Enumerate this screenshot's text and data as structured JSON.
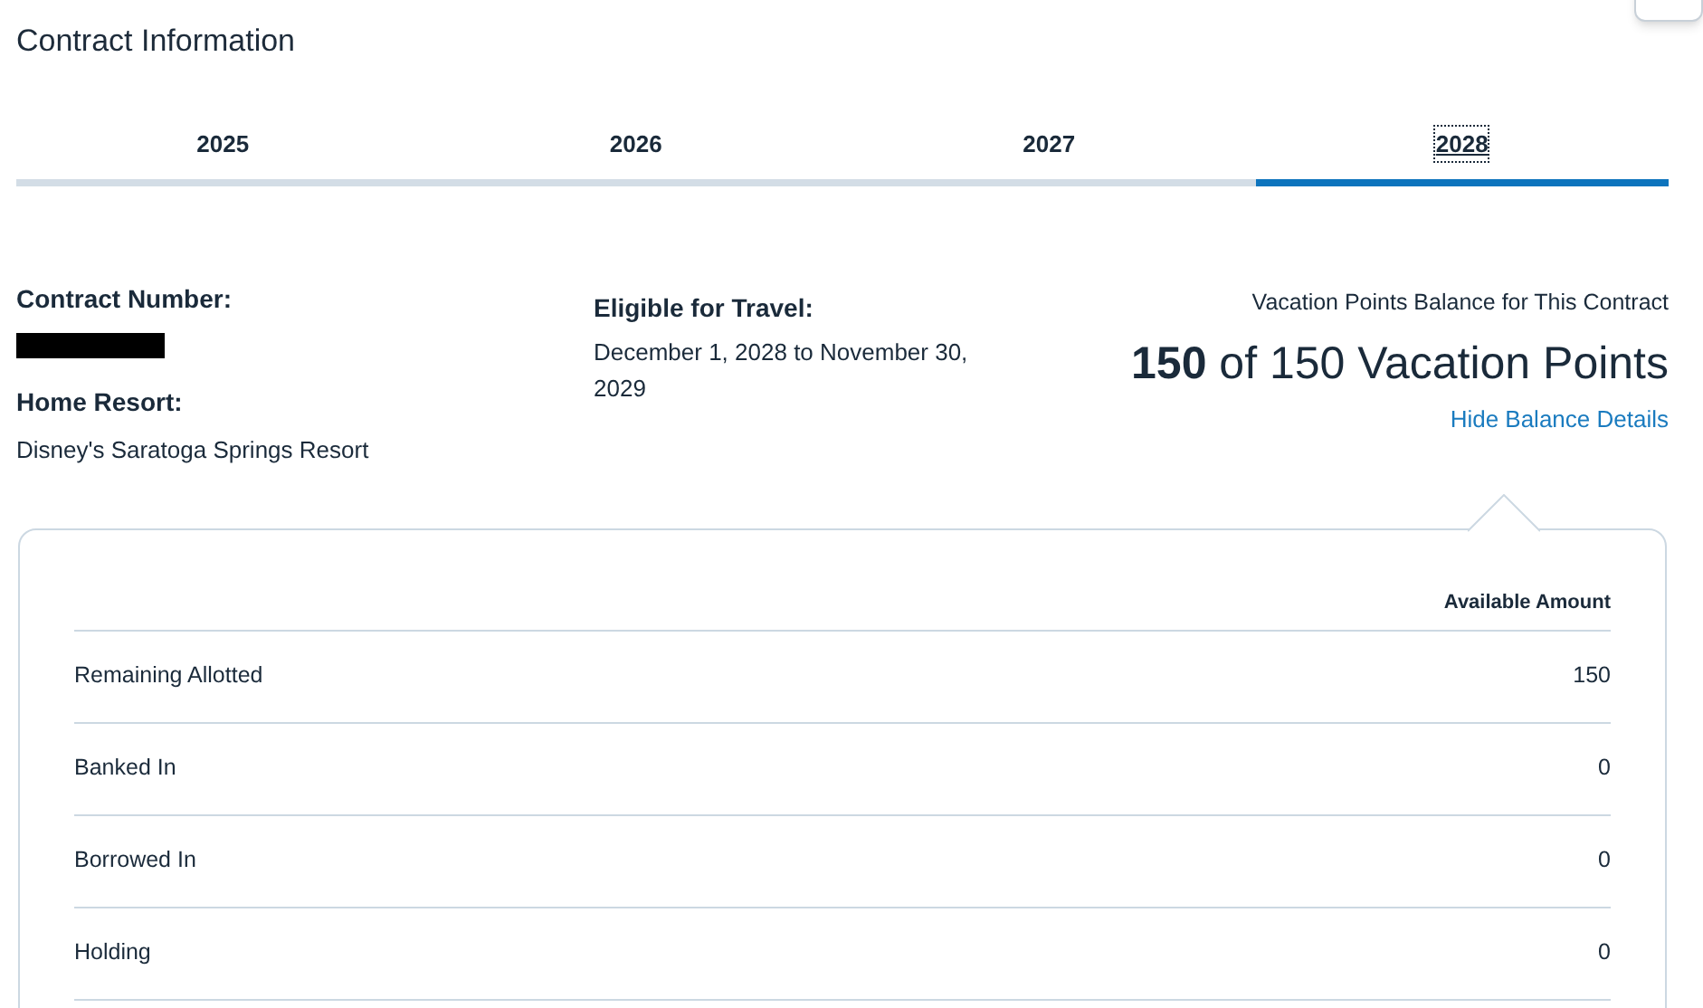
{
  "title": "Contract Information",
  "tabs": [
    {
      "label": "2025",
      "selected": false
    },
    {
      "label": "2026",
      "selected": false
    },
    {
      "label": "2027",
      "selected": false
    },
    {
      "label": "2028",
      "selected": true
    }
  ],
  "contract": {
    "number_label": "Contract Number:",
    "home_resort_label": "Home Resort:",
    "home_resort": "Disney's Saratoga Springs Resort",
    "eligible_label": "Eligible for Travel:",
    "eligible": "December 1, 2028 to November 30, 2029"
  },
  "balance": {
    "caption": "Vacation Points Balance for This Contract",
    "summary": "**150** of 150 Vacation Points",
    "toggle_link": "Hide Balance Details",
    "expanded": true
  },
  "table": {
    "columns": [
      "Available Amount"
    ],
    "rows": [
      {
        "label": "Remaining Allotted",
        "amount": "150"
      },
      {
        "label": "Banked In",
        "amount": "0"
      },
      {
        "label": "Borrowed In",
        "amount": "0"
      },
      {
        "label": "Holding",
        "amount": "0"
      }
    ]
  }
}
